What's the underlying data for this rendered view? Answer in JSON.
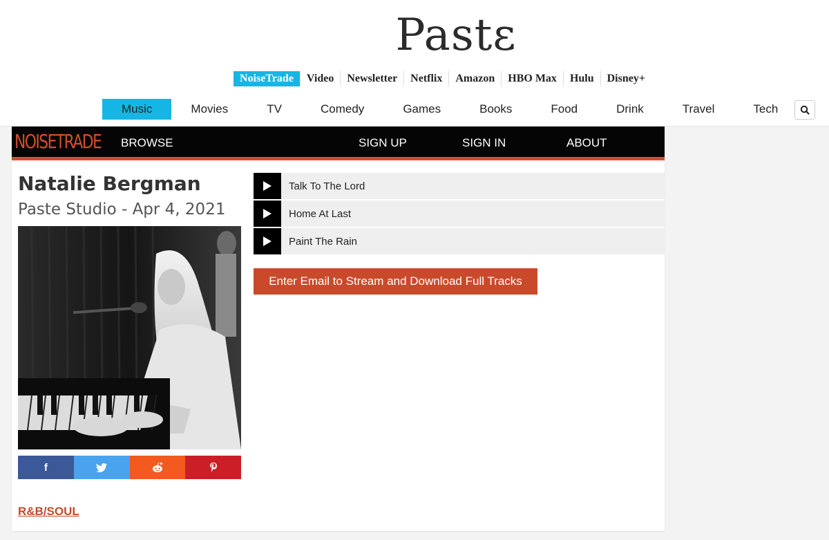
{
  "site": {
    "logo": "Pastɛ"
  },
  "top_links": [
    "NoiseTrade",
    "Video",
    "Newsletter",
    "Netflix",
    "Amazon",
    "HBO Max",
    "Hulu",
    "Disney+"
  ],
  "main_nav": [
    "Music",
    "Movies",
    "TV",
    "Comedy",
    "Games",
    "Books",
    "Food",
    "Drink",
    "Travel",
    "Tech"
  ],
  "noisetrade": {
    "logo": "NOISETRADE",
    "browse": "BROWSE",
    "sign_up": "SIGN UP",
    "sign_in": "SIGN IN",
    "about": "ABOUT"
  },
  "album": {
    "artist": "Natalie Bergman",
    "subtitle": "Paste Studio - Apr 4, 2021",
    "genre": "R&B/SOUL"
  },
  "share": {
    "facebook": "f",
    "reddit": "●",
    "pinterest": "P"
  },
  "tracks": [
    "Talk To The Lord",
    "Home At Last",
    "Paint The Rain"
  ],
  "cta": "Enter Email to Stream and Download Full Tracks",
  "colors": {
    "accent_blue": "#16b6e4",
    "noisetrade_orange": "#d24f2c",
    "facebook": "#3b5998",
    "twitter": "#4aa3ef",
    "reddit": "#f25a1f",
    "pinterest": "#cb1f27"
  }
}
